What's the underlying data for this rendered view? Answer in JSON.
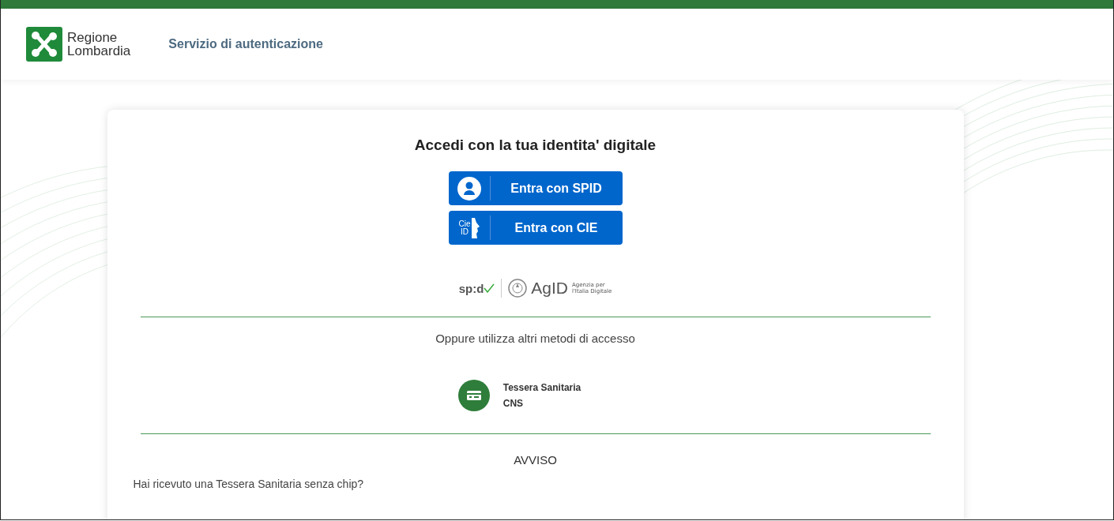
{
  "header": {
    "logo_lines": [
      "Regione",
      "Lombardia"
    ],
    "title": "Servizio di autenticazione"
  },
  "card": {
    "heading": "Accedi con la tua identita' digitale",
    "login_buttons": [
      {
        "kind": "spid",
        "label": "Entra con SPID"
      },
      {
        "kind": "cie",
        "label": "Entra con CIE",
        "icon_text": [
          "Cie",
          "ID"
        ]
      }
    ],
    "partner_logos": {
      "spid": "sp:d",
      "agid": "AgID",
      "agid_caption": [
        "Agenzia per",
        "l'Italia Digitale"
      ]
    },
    "alt_methods_text": "Oppure utilizza altri metodi di accesso",
    "alt_methods": [
      {
        "title": "Tessera Sanitaria",
        "subtitle": "CNS"
      }
    ],
    "notice_title": "AVVISO",
    "notice_text": "Hai ricevuto una Tessera Sanitaria senza chip?"
  }
}
